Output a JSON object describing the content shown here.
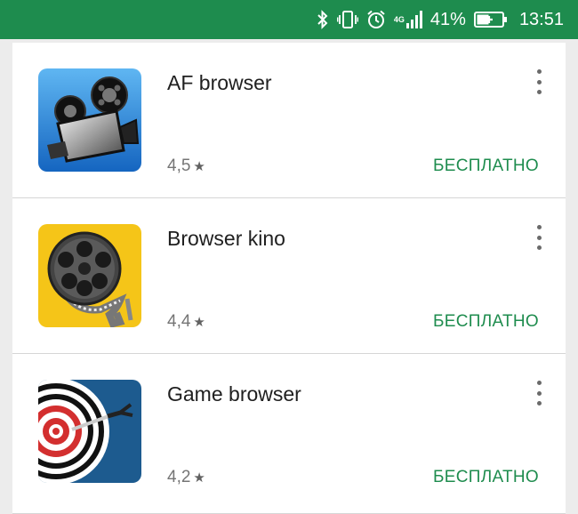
{
  "status_bar": {
    "network_label": "4G",
    "battery_percent": "41%",
    "time": "13:51",
    "icons": [
      "bluetooth-icon",
      "vibrate-icon",
      "alarm-icon",
      "signal-icon",
      "battery-charging-icon"
    ]
  },
  "apps": [
    {
      "title": "AF browser",
      "rating": "4,5",
      "price": "БЕСПЛАТНО",
      "icon": "movie-camera-icon"
    },
    {
      "title": "Browser kino",
      "rating": "4,4",
      "price": "БЕСПЛАТНО",
      "icon": "film-reel-icon"
    },
    {
      "title": "Game browser",
      "rating": "4,2",
      "price": "БЕСПЛАТНО",
      "icon": "dartboard-icon"
    }
  ],
  "colors": {
    "status_bar": "#1e8c4e",
    "accent_green": "#1e8c4e",
    "icon_blue": "#1f7fd6",
    "icon_yellow": "#f5c518",
    "icon_navy": "#1d5b8f"
  }
}
